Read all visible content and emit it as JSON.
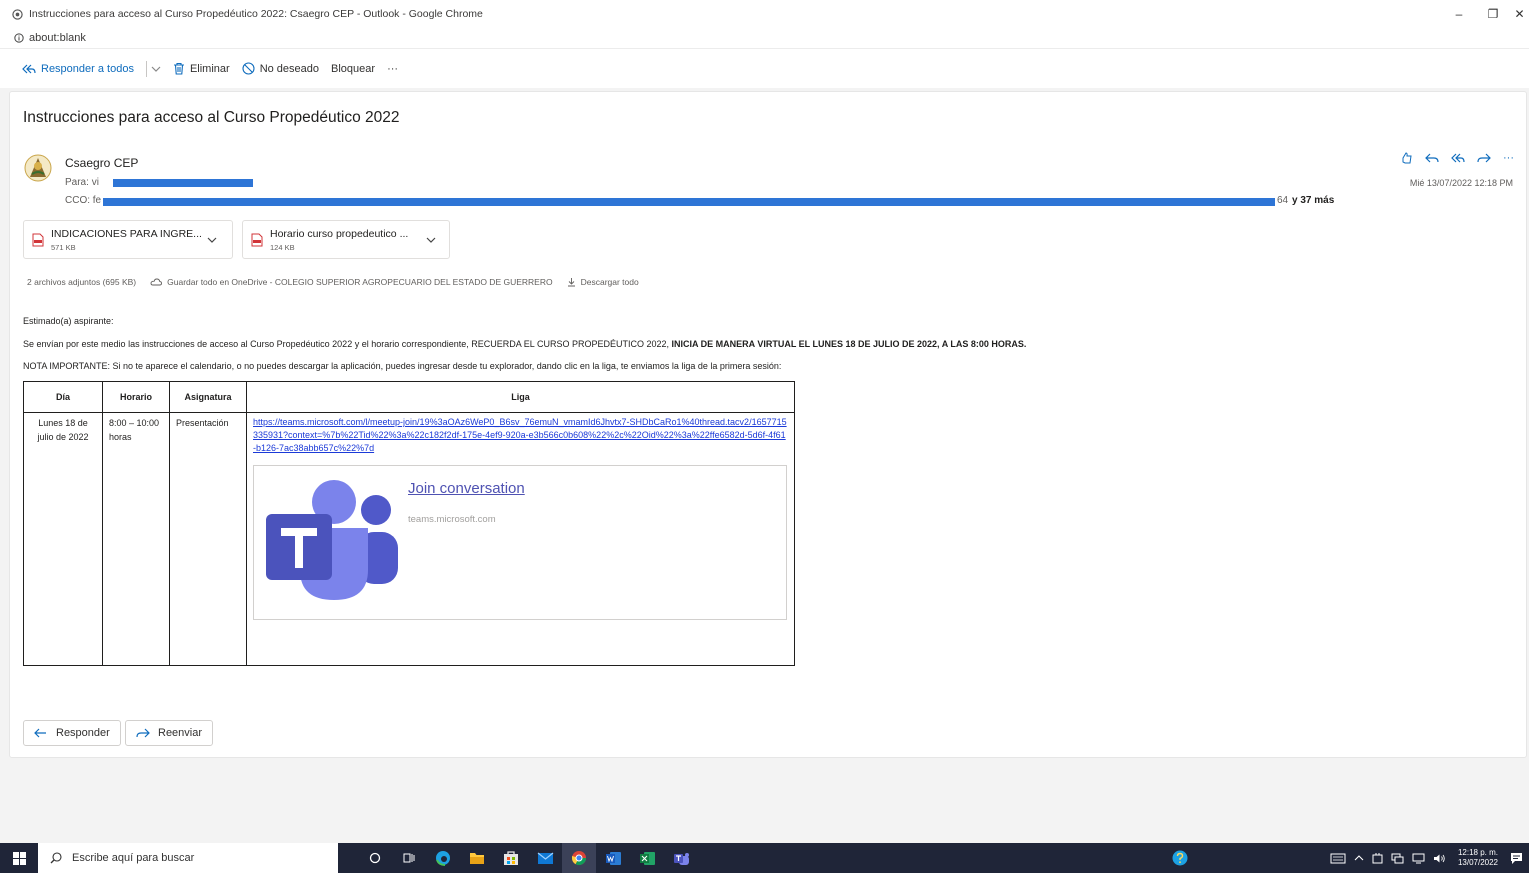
{
  "window": {
    "title": "Instrucciones para acceso al Curso Propedéutico 2022: Csaegro CEP - Outlook - Google Chrome",
    "address": "about:blank",
    "minimize": "–",
    "restore": "❐",
    "close": "✕"
  },
  "toolbar": {
    "reply_all": "Responder a todos",
    "delete": "Eliminar",
    "junk": "No deseado",
    "block": "Bloquear",
    "more": "···"
  },
  "message": {
    "subject": "Instrucciones para acceso al Curso Propedéutico 2022",
    "sender": "Csaegro CEP",
    "to_label": "Para:",
    "to_visible": "vi",
    "cc_label": "CCO:",
    "cc_visible": "fe",
    "cc_tail": "64",
    "cc_more": "y 37 más",
    "date": "Mié 13/07/2022 12:18 PM"
  },
  "attachments": [
    {
      "name": "INDICACIONES PARA INGRE...",
      "size": "571 KB"
    },
    {
      "name": "Horario curso propedeutico ...",
      "size": "124 KB"
    }
  ],
  "attachments_bar": {
    "count": "2 archivos adjuntos (695 KB)",
    "save": "Guardar todo en OneDrive - COLEGIO SUPERIOR AGROPECUARIO DEL ESTADO DE GUERRERO",
    "download": "Descargar todo"
  },
  "body": {
    "greeting": "Estimado(a) aspirante:",
    "p2_normal": "Se envían por este medio las instrucciones de acceso al Curso Propedéutico 2022 y el horario correspondiente, RECUERDA EL CURSO PROPEDÉUTICO 2022, ",
    "p2_bold": "INICIA DE MANERA VIRTUAL EL LUNES 18 DE JULIO DE 2022, A LAS 8:00 HORAS.",
    "p3": "NOTA IMPORTANTE: Si no te aparece el calendario, o no puedes descargar la aplicación, puedes ingresar desde tu explorador, dando clic en la liga, te enviamos la liga de la primera sesión:"
  },
  "table": {
    "headers": [
      "Día",
      "Horario",
      "Asignatura",
      "Liga"
    ],
    "rows": [
      {
        "day": "Lunes 18 de julio de 2022",
        "time": "8:00 – 10:00 horas",
        "subject": "Presentación",
        "link": "https://teams.microsoft.com/l/meetup-join/19%3aOAz6WeP0_B6sv_76emuN_vmamId6Jhvtx7-SHDbCaRo1%40thread.tacv2/1657715335931?context=%7b%22Tid%22%3a%22c182f2df-175e-4ef9-920a-e3b566c0b608%22%2c%22Oid%22%3a%22ffe6582d-5d6f-4f61-b126-7ac38abb657c%22%7d"
      }
    ]
  },
  "teams_card": {
    "title": "Join conversation",
    "domain": "teams.microsoft.com"
  },
  "actions": {
    "reply": "Responder",
    "forward": "Reenviar"
  },
  "taskbar": {
    "search_placeholder": "Escribe aquí para buscar",
    "time": "12:18 p. m.",
    "date": "13/07/2022"
  },
  "colors": {
    "accent": "#0f6cbd",
    "teams_purple": "#5059c9",
    "redaction": "#2e75d6",
    "taskbar": "#1f2538"
  }
}
